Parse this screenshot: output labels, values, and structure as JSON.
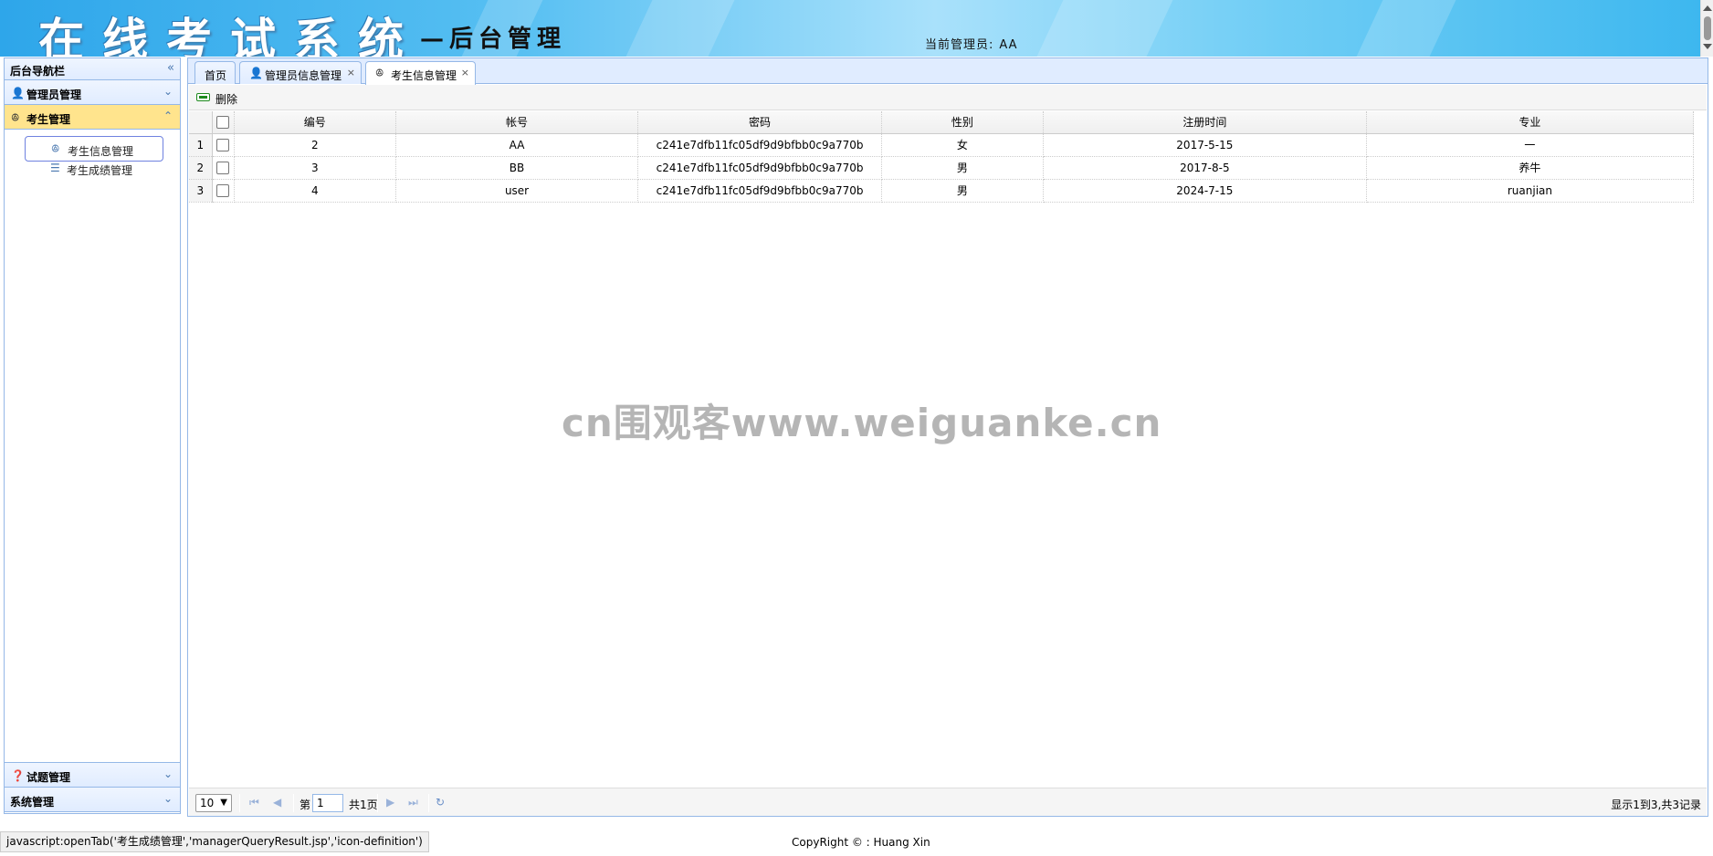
{
  "header": {
    "title": "在线考试系统",
    "subtitle": "—后台管理",
    "admin_label": "当前管理员:",
    "admin_name": "AA"
  },
  "west": {
    "title": "后台导航栏",
    "sections": [
      {
        "label": "管理员管理",
        "icon": "user-icon"
      },
      {
        "label": "考生管理",
        "icon": "students-icon",
        "selected": true
      },
      {
        "label": "试题管理",
        "icon": "help-icon"
      },
      {
        "label": "系统管理",
        "icon": "none"
      }
    ],
    "links": [
      {
        "label": "考生信息管理",
        "icon": "students-icon",
        "active": true
      },
      {
        "label": "考生成绩管理",
        "icon": "definition-icon"
      }
    ]
  },
  "tabs": [
    {
      "label": "首页",
      "closable": false
    },
    {
      "label": "管理员信息管理",
      "icon": "user-icon",
      "closable": true
    },
    {
      "label": "考生信息管理",
      "icon": "students-icon",
      "closable": true,
      "active": true
    }
  ],
  "toolbar": {
    "delete_label": "删除"
  },
  "grid": {
    "columns": [
      "编号",
      "帐号",
      "密码",
      "性别",
      "注册时间",
      "专业"
    ],
    "rows": [
      {
        "rownum": "1",
        "id": "2",
        "account": "AA",
        "password": "c241e7dfb11fc05df9d9bfbb0c9a770b",
        "gender": "女",
        "reg_time": "2017-5-15",
        "major": "一"
      },
      {
        "rownum": "2",
        "id": "3",
        "account": "BB",
        "password": "c241e7dfb11fc05df9d9bfbb0c9a770b",
        "gender": "男",
        "reg_time": "2017-8-5",
        "major": "养牛"
      },
      {
        "rownum": "3",
        "id": "4",
        "account": "user",
        "password": "c241e7dfb11fc05df9d9bfbb0c9a770b",
        "gender": "男",
        "reg_time": "2024-7-15",
        "major": "ruanjian"
      }
    ]
  },
  "watermark": "cn围观客www.weiguanke.cn",
  "pager": {
    "page_size": "10",
    "page_prefix": "第",
    "page_value": "1",
    "page_total": "共1页",
    "info": "显示1到3,共3记录"
  },
  "footer": {
    "copyright": "CopyRight © : Huang Xin",
    "status_url": "javascript:openTab('考生成绩管理','managerQueryResult.jsp','icon-definition')"
  },
  "colors": {
    "border": "#95b8e7",
    "panel_header": "#e0ecff",
    "selected_section": "#ffe48d"
  }
}
